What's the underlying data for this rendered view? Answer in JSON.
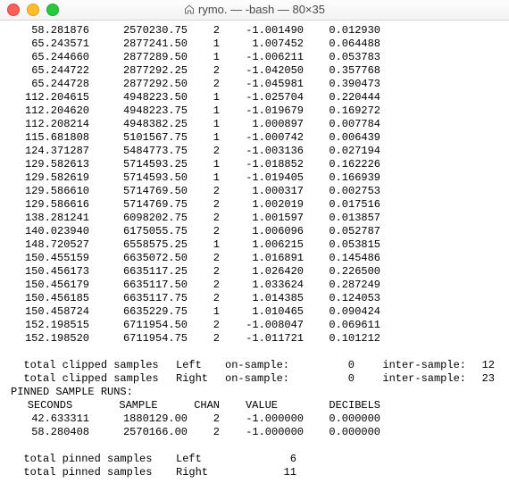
{
  "window": {
    "title": "rymo. — -bash — 80×35"
  },
  "table": {
    "rows": [
      {
        "seconds": "58.281876",
        "sample": "2570230.75",
        "chan": "2",
        "value": "-1.001490",
        "decibels": "0.012930"
      },
      {
        "seconds": "65.243571",
        "sample": "2877241.50",
        "chan": "1",
        "value": "1.007452",
        "decibels": "0.064488"
      },
      {
        "seconds": "65.244660",
        "sample": "2877289.50",
        "chan": "1",
        "value": "-1.006211",
        "decibels": "0.053783"
      },
      {
        "seconds": "65.244722",
        "sample": "2877292.25",
        "chan": "2",
        "value": "-1.042050",
        "decibels": "0.357768"
      },
      {
        "seconds": "65.244728",
        "sample": "2877292.50",
        "chan": "2",
        "value": "-1.045981",
        "decibels": "0.390473"
      },
      {
        "seconds": "112.204615",
        "sample": "4948223.50",
        "chan": "1",
        "value": "-1.025704",
        "decibels": "0.220444"
      },
      {
        "seconds": "112.204620",
        "sample": "4948223.75",
        "chan": "1",
        "value": "-1.019679",
        "decibels": "0.169272"
      },
      {
        "seconds": "112.208214",
        "sample": "4948382.25",
        "chan": "1",
        "value": "1.000897",
        "decibels": "0.007784"
      },
      {
        "seconds": "115.681808",
        "sample": "5101567.75",
        "chan": "1",
        "value": "-1.000742",
        "decibels": "0.006439"
      },
      {
        "seconds": "124.371287",
        "sample": "5484773.75",
        "chan": "2",
        "value": "-1.003136",
        "decibels": "0.027194"
      },
      {
        "seconds": "129.582613",
        "sample": "5714593.25",
        "chan": "1",
        "value": "-1.018852",
        "decibels": "0.162226"
      },
      {
        "seconds": "129.582619",
        "sample": "5714593.50",
        "chan": "1",
        "value": "-1.019405",
        "decibels": "0.166939"
      },
      {
        "seconds": "129.586610",
        "sample": "5714769.50",
        "chan": "2",
        "value": "1.000317",
        "decibels": "0.002753"
      },
      {
        "seconds": "129.586616",
        "sample": "5714769.75",
        "chan": "2",
        "value": "1.002019",
        "decibels": "0.017516"
      },
      {
        "seconds": "138.281241",
        "sample": "6098202.75",
        "chan": "2",
        "value": "1.001597",
        "decibels": "0.013857"
      },
      {
        "seconds": "140.023940",
        "sample": "6175055.75",
        "chan": "2",
        "value": "1.006096",
        "decibels": "0.052787"
      },
      {
        "seconds": "148.720527",
        "sample": "6558575.25",
        "chan": "1",
        "value": "1.006215",
        "decibels": "0.053815"
      },
      {
        "seconds": "150.455159",
        "sample": "6635072.50",
        "chan": "2",
        "value": "1.016891",
        "decibels": "0.145486"
      },
      {
        "seconds": "150.456173",
        "sample": "6635117.25",
        "chan": "2",
        "value": "1.026420",
        "decibels": "0.226500"
      },
      {
        "seconds": "150.456179",
        "sample": "6635117.50",
        "chan": "2",
        "value": "1.033624",
        "decibels": "0.287249"
      },
      {
        "seconds": "150.456185",
        "sample": "6635117.75",
        "chan": "2",
        "value": "1.014385",
        "decibels": "0.124053"
      },
      {
        "seconds": "150.458724",
        "sample": "6635229.75",
        "chan": "1",
        "value": "1.010465",
        "decibels": "0.090424"
      },
      {
        "seconds": "152.198515",
        "sample": "6711954.50",
        "chan": "2",
        "value": "-1.008047",
        "decibels": "0.069611"
      },
      {
        "seconds": "152.198520",
        "sample": "6711954.75",
        "chan": "2",
        "value": "-1.011721",
        "decibels": "0.101212"
      }
    ]
  },
  "clipped_summary": {
    "label_prefix": "  total clipped samples",
    "left_label": "Left",
    "right_label": "Right",
    "on_sample_label": "on-sample:",
    "inter_sample_label": "inter-sample:",
    "left": {
      "on_sample": "0",
      "inter_sample": "12"
    },
    "right": {
      "on_sample": "0",
      "inter_sample": "23"
    }
  },
  "pinned": {
    "title": "PINNED SAMPLE RUNS:",
    "headers": {
      "seconds": "SECONDS",
      "sample": "SAMPLE",
      "chan": "CHAN",
      "value": "VALUE",
      "decibels": "DECIBELS"
    },
    "rows": [
      {
        "seconds": "42.633311",
        "sample": "1880129.00",
        "chan": "2",
        "value": "-1.000000",
        "decibels": "0.000000"
      },
      {
        "seconds": "58.280408",
        "sample": "2570166.00",
        "chan": "2",
        "value": "-1.000000",
        "decibels": "0.000000"
      }
    ],
    "totals": {
      "label_prefix": "  total pinned samples",
      "left_label": "Left",
      "right_label": "Right",
      "left": "6",
      "right": "11"
    }
  }
}
